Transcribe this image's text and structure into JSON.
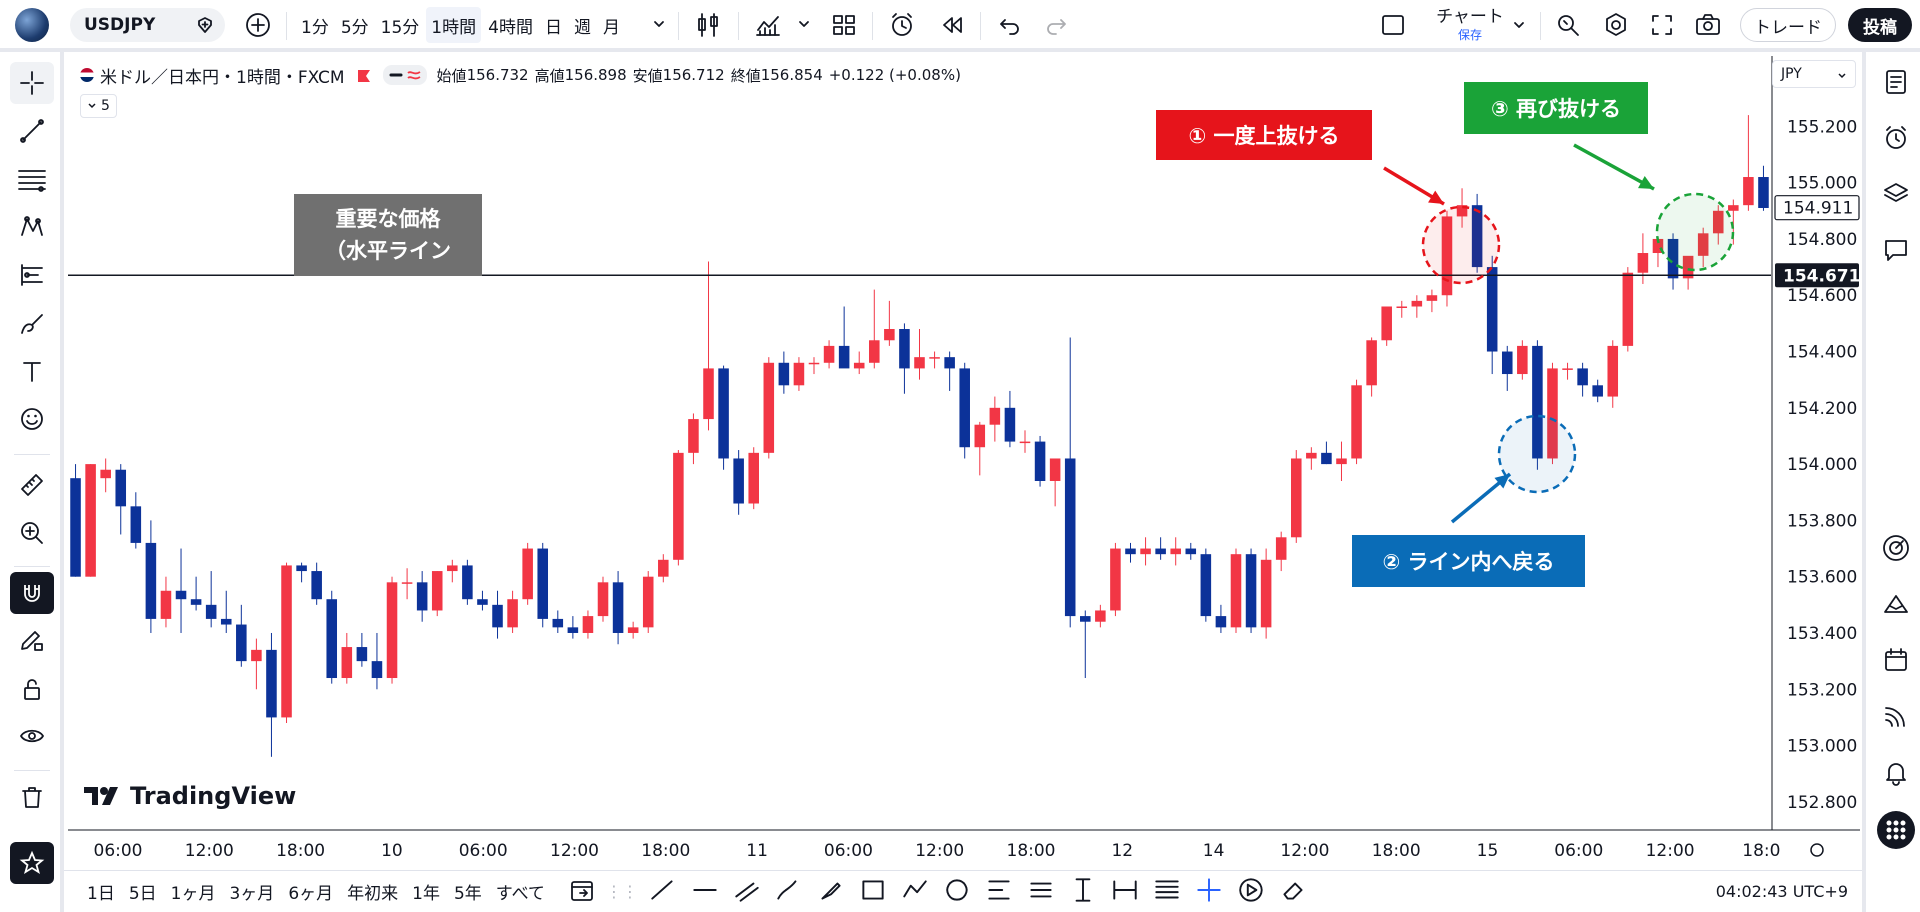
{
  "topbar": {
    "symbol": "USDJPY",
    "intervals": [
      "1分",
      "5分",
      "15分",
      "1時間",
      "4時間",
      "日",
      "週",
      "月"
    ],
    "active_interval": "1時間",
    "layout_label": "チャート",
    "layout_sublabel": "保存",
    "trade_label": "トレード",
    "publish_label": "投稿"
  },
  "legend": {
    "title": "米ドル／日本円・1時間・FXCM",
    "open_label": "始値",
    "open": "156.732",
    "high_label": "高値",
    "high": "156.898",
    "low_label": "安値",
    "low": "156.712",
    "close_label": "終値",
    "close": "156.854",
    "change": "+0.122 (+0.08%)",
    "collapse_count": "5"
  },
  "currency_select": "JPY",
  "price_axis": {
    "ticks": [
      "155.200",
      "155.000",
      "154.800",
      "154.600",
      "154.400",
      "154.200",
      "154.000",
      "153.800",
      "153.600",
      "153.400",
      "153.200",
      "153.000",
      "152.800"
    ],
    "last_price_tag": "154.911",
    "line_price_tag": "154.671"
  },
  "time_axis": {
    "ticks": [
      "06:00",
      "12:00",
      "18:00",
      "10",
      "06:00",
      "12:00",
      "18:00",
      "11",
      "06:00",
      "12:00",
      "18:00",
      "12",
      "14",
      "12:00",
      "18:00",
      "15",
      "06:00",
      "12:00",
      "18:0"
    ]
  },
  "annotations": {
    "key_level_line1": "重要な価格",
    "key_level_line2": "（水平ライン",
    "step1": "① 一度上抜ける",
    "step2": "② ライン内へ戻る",
    "step3": "③ 再び抜ける"
  },
  "colors": {
    "up": "#f23645",
    "down": "#0c3299",
    "step1": "#e6141b",
    "step2": "#0a6cb7",
    "step3": "#1aa338",
    "key_box": "#707070",
    "line": "#131722"
  },
  "watermark": "TradingView",
  "bottombar": {
    "ranges": [
      "1日",
      "5日",
      "1ヶ月",
      "3ヶ月",
      "6ヶ月",
      "年初来",
      "1年",
      "5年",
      "すべて"
    ],
    "clock": "04:02:43 UTC+9"
  },
  "chart_data": {
    "type": "candlestick",
    "symbol": "USDJPY",
    "ylim": [
      152.7,
      155.45
    ],
    "horizontal_line": 154.671,
    "candles": [
      [
        153.95,
        154.0,
        153.6,
        153.6
      ],
      [
        153.6,
        154.0,
        153.6,
        154.0
      ],
      [
        153.95,
        154.02,
        153.9,
        153.98
      ],
      [
        153.98,
        154.0,
        153.75,
        153.85
      ],
      [
        153.85,
        153.9,
        153.7,
        153.72
      ],
      [
        153.72,
        153.8,
        153.4,
        153.45
      ],
      [
        153.45,
        153.6,
        153.42,
        153.55
      ],
      [
        153.55,
        153.7,
        153.4,
        153.52
      ],
      [
        153.52,
        153.6,
        153.48,
        153.5
      ],
      [
        153.5,
        153.62,
        153.42,
        153.45
      ],
      [
        153.45,
        153.55,
        153.4,
        153.43
      ],
      [
        153.43,
        153.5,
        153.28,
        153.3
      ],
      [
        153.3,
        153.38,
        153.2,
        153.34
      ],
      [
        153.34,
        153.4,
        152.96,
        153.1
      ],
      [
        153.1,
        153.65,
        153.08,
        153.64
      ],
      [
        153.64,
        153.65,
        153.58,
        153.62
      ],
      [
        153.62,
        153.65,
        153.5,
        153.52
      ],
      [
        153.52,
        153.55,
        153.22,
        153.24
      ],
      [
        153.24,
        153.4,
        153.22,
        153.35
      ],
      [
        153.35,
        153.4,
        153.28,
        153.3
      ],
      [
        153.3,
        153.4,
        153.2,
        153.24
      ],
      [
        153.24,
        153.6,
        153.22,
        153.58
      ],
      [
        153.58,
        153.63,
        153.52,
        153.58
      ],
      [
        153.58,
        153.62,
        153.44,
        153.48
      ],
      [
        153.48,
        153.62,
        153.46,
        153.62
      ],
      [
        153.62,
        153.66,
        153.58,
        153.64
      ],
      [
        153.64,
        153.66,
        153.5,
        153.52
      ],
      [
        153.52,
        153.55,
        153.48,
        153.5
      ],
      [
        153.5,
        153.55,
        153.38,
        153.42
      ],
      [
        153.42,
        153.55,
        153.4,
        153.52
      ],
      [
        153.52,
        153.72,
        153.5,
        153.7
      ],
      [
        153.7,
        153.72,
        153.42,
        153.45
      ],
      [
        153.45,
        153.48,
        153.4,
        153.42
      ],
      [
        153.42,
        153.46,
        153.38,
        153.4
      ],
      [
        153.4,
        153.48,
        153.38,
        153.46
      ],
      [
        153.46,
        153.6,
        153.44,
        153.58
      ],
      [
        153.58,
        153.62,
        153.36,
        153.4
      ],
      [
        153.4,
        153.44,
        153.38,
        153.42
      ],
      [
        153.42,
        153.62,
        153.4,
        153.6
      ],
      [
        153.6,
        153.68,
        153.58,
        153.66
      ],
      [
        153.66,
        154.05,
        153.64,
        154.04
      ],
      [
        154.04,
        154.18,
        154.0,
        154.16
      ],
      [
        154.16,
        154.72,
        154.12,
        154.34
      ],
      [
        154.34,
        154.35,
        153.98,
        154.02
      ],
      [
        154.02,
        154.05,
        153.82,
        153.86
      ],
      [
        153.86,
        154.06,
        153.84,
        154.04
      ],
      [
        154.04,
        154.38,
        154.02,
        154.36
      ],
      [
        154.36,
        154.4,
        154.25,
        154.28
      ],
      [
        154.28,
        154.38,
        154.26,
        154.36
      ],
      [
        154.36,
        154.38,
        154.32,
        154.36
      ],
      [
        154.36,
        154.44,
        154.34,
        154.42
      ],
      [
        154.42,
        154.56,
        154.38,
        154.34
      ],
      [
        154.34,
        154.4,
        154.32,
        154.36
      ],
      [
        154.36,
        154.62,
        154.34,
        154.44
      ],
      [
        154.44,
        154.58,
        154.42,
        154.48
      ],
      [
        154.48,
        154.5,
        154.25,
        154.34
      ],
      [
        154.34,
        154.48,
        154.3,
        154.38
      ],
      [
        154.38,
        154.4,
        154.34,
        154.38
      ],
      [
        154.38,
        154.4,
        154.26,
        154.34
      ],
      [
        154.34,
        154.36,
        154.02,
        154.06
      ],
      [
        154.06,
        154.15,
        153.96,
        154.14
      ],
      [
        154.14,
        154.24,
        154.08,
        154.2
      ],
      [
        154.2,
        154.26,
        154.06,
        154.08
      ],
      [
        154.08,
        154.12,
        154.04,
        154.08
      ],
      [
        154.08,
        154.1,
        153.92,
        153.94
      ],
      [
        153.94,
        153.95,
        153.85,
        154.02
      ],
      [
        154.02,
        154.45,
        153.42,
        153.46
      ],
      [
        153.46,
        153.48,
        153.24,
        153.44
      ],
      [
        153.44,
        153.5,
        153.42,
        153.48
      ],
      [
        153.48,
        153.72,
        153.46,
        153.7
      ],
      [
        153.7,
        153.72,
        153.65,
        153.68
      ],
      [
        153.68,
        153.74,
        153.64,
        153.7
      ],
      [
        153.7,
        153.74,
        153.66,
        153.68
      ],
      [
        153.68,
        153.74,
        153.64,
        153.7
      ],
      [
        153.7,
        153.72,
        153.66,
        153.68
      ],
      [
        153.68,
        153.7,
        153.44,
        153.46
      ],
      [
        153.46,
        153.5,
        153.4,
        153.42
      ],
      [
        153.42,
        153.7,
        153.4,
        153.68
      ],
      [
        153.68,
        153.7,
        153.4,
        153.42
      ],
      [
        153.42,
        153.7,
        153.38,
        153.66
      ],
      [
        153.66,
        153.76,
        153.62,
        153.74
      ],
      [
        153.74,
        154.05,
        153.72,
        154.02
      ],
      [
        154.02,
        154.06,
        153.98,
        154.04
      ],
      [
        154.04,
        154.08,
        154.0,
        154.0
      ],
      [
        154.0,
        154.08,
        153.94,
        154.02
      ],
      [
        154.02,
        154.3,
        154.0,
        154.28
      ],
      [
        154.28,
        154.45,
        154.24,
        154.44
      ],
      [
        154.44,
        154.56,
        154.42,
        154.56
      ],
      [
        154.56,
        154.58,
        154.52,
        154.56
      ],
      [
        154.56,
        154.6,
        154.52,
        154.58
      ],
      [
        154.58,
        154.62,
        154.54,
        154.6
      ],
      [
        154.6,
        154.9,
        154.56,
        154.88
      ],
      [
        154.88,
        154.98,
        154.84,
        154.92
      ],
      [
        154.92,
        154.96,
        154.68,
        154.7
      ],
      [
        154.7,
        154.74,
        154.32,
        154.4
      ],
      [
        154.4,
        154.42,
        154.26,
        154.32
      ],
      [
        154.32,
        154.44,
        154.3,
        154.42
      ],
      [
        154.42,
        154.44,
        153.98,
        154.02
      ],
      [
        154.02,
        154.36,
        154.0,
        154.34
      ],
      [
        154.34,
        154.36,
        154.3,
        154.34
      ],
      [
        154.34,
        154.36,
        154.24,
        154.28
      ],
      [
        154.28,
        154.3,
        154.22,
        154.24
      ],
      [
        154.24,
        154.44,
        154.2,
        154.42
      ],
      [
        154.42,
        154.7,
        154.4,
        154.68
      ],
      [
        154.68,
        154.82,
        154.64,
        154.75
      ],
      [
        154.75,
        154.8,
        154.7,
        154.8
      ],
      [
        154.8,
        154.82,
        154.62,
        154.66
      ],
      [
        154.66,
        154.72,
        154.62,
        154.74
      ],
      [
        154.74,
        154.84,
        154.7,
        154.82
      ],
      [
        154.82,
        154.92,
        154.78,
        154.9
      ],
      [
        154.9,
        154.94,
        154.78,
        154.92
      ],
      [
        154.92,
        155.24,
        154.9,
        155.02
      ],
      [
        155.02,
        155.06,
        154.9,
        154.91
      ]
    ]
  }
}
